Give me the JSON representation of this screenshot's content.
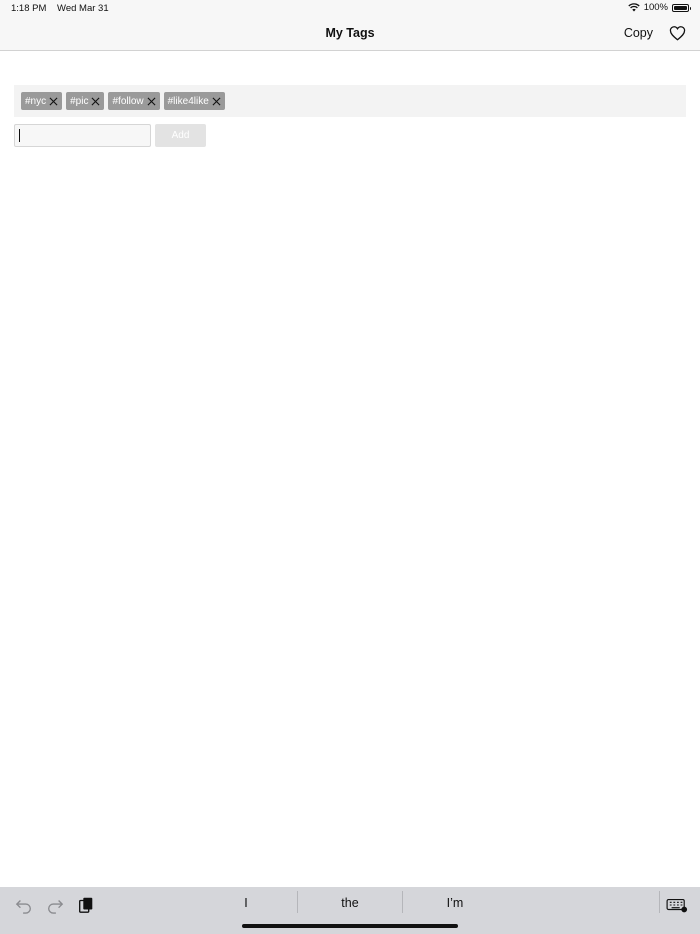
{
  "status": {
    "time": "1:18 PM",
    "date": "Wed Mar 31",
    "battery": "100%"
  },
  "nav": {
    "title": "My Tags",
    "copy_label": "Copy"
  },
  "tags": [
    "#nyc",
    "#pic",
    "#follow",
    "#like4like"
  ],
  "input": {
    "value": "",
    "placeholder": ""
  },
  "add_label": "Add",
  "suggestions": [
    "I",
    "the",
    "I’m"
  ],
  "colors": {
    "tag_bg": "#9a9a9a",
    "tag_area_bg": "#f3f3f3",
    "keyboard_bar_bg": "#d5d6da"
  }
}
